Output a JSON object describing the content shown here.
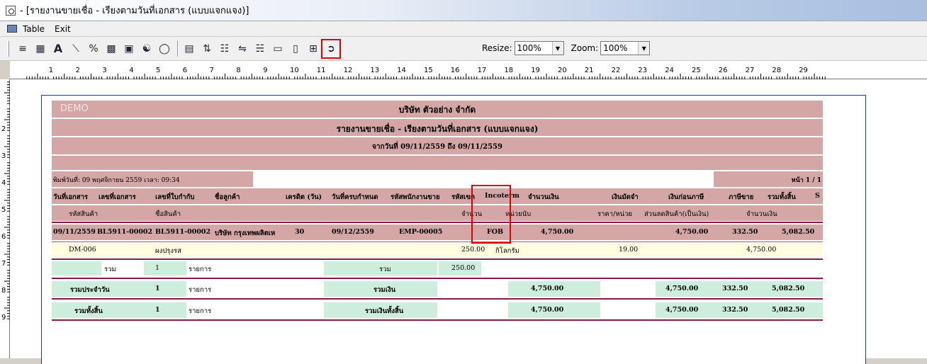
{
  "window": {
    "title": " - [รายงานขายเชื่อ - เรียงตามวันที่เอกสาร (แบบแจกแจง)]"
  },
  "menu": {
    "items": [
      "Table",
      "Exit"
    ]
  },
  "toolbar": {
    "resize_label": "Resize:",
    "resize_value": "100%",
    "zoom_label": "Zoom:",
    "zoom_value": "100%",
    "icons": [
      "align-left-icon",
      "table-icon",
      "text-icon",
      "line-icon",
      "percent-icon",
      "grid-icon",
      "image-icon",
      "stamp-icon",
      "eraser-icon",
      "report-icon",
      "sort-icon",
      "group-icon",
      "merge-icon",
      "split-icon",
      "column-icon",
      "row-icon",
      "fit-icon",
      "exit-icon"
    ]
  },
  "ruler": {
    "marks": [
      "1",
      "2",
      "3",
      "4",
      "5",
      "6",
      "7",
      "8",
      "9",
      "10",
      "11",
      "12",
      "13",
      "14",
      "15",
      "16",
      "17",
      "18",
      "19",
      "20",
      "21",
      "22",
      "23",
      "24",
      "25",
      "26",
      "27",
      "28",
      "29"
    ]
  },
  "vruler": {
    "marks": [
      "2",
      "3",
      "4",
      "5",
      "6",
      "7",
      "8",
      "9"
    ]
  },
  "report": {
    "watermark": "DEMO",
    "company": "บริษัท ตัวอย่าง จำกัด",
    "title": "รายงานขายเชื่อ - เรียงตามวันที่เอกสาร (แบบแจกแจง)",
    "date_range": "จากวันที่ 09/11/2559 ถึง 09/11/2559",
    "printed": "พิมพ์วันที่: 09 พฤศจิกายน 2559 เวลา: 09:34",
    "page": "หน้า 1 / 1",
    "headers1": [
      "วันที่เอกสาร",
      "เลขที่เอกสาร",
      "เลขที่ใบกำกับ",
      "ชื่อลูกค้า",
      "เครดิต (วัน)",
      "วันที่ครบกำหนด",
      "รหัสพนักงานขาย",
      "รหัสเขต",
      "Incoterm",
      "จำนวนเงิน",
      "เงินมัดจำ",
      "เงินก่อนภาษี",
      "ภาษีขาย",
      "รวมทั้งสิ้น",
      "S"
    ],
    "headers2": [
      "รหัสสินค้า",
      "ชื่อสินค้า",
      "จำนวน",
      "หน่วยนับ",
      "ราคา/หน่วย",
      "ส่วนลดสินค้า(เป็นเงิน)",
      "จำนวนเงิน"
    ],
    "doc_row": [
      "09/11/2559",
      "BL5911-00002",
      "BL5911-00002",
      "บริษัท กรุงเทพผลิตเห",
      "30",
      "09/12/2559",
      "EMP-00005",
      "FOB",
      "4,750.00",
      "4,750.00",
      "332.50",
      "5,082.50"
    ],
    "item_row": [
      "DM-006",
      "ผงปรุงรส",
      "250.00",
      "กิโลกรัม",
      "19.00",
      "4,750.00"
    ],
    "sum_row": [
      "รวม",
      "1",
      "รายการ",
      "รวม",
      "250.00"
    ],
    "daily_row": [
      "รวมประจำวัน",
      "1",
      "รายการ",
      "รวมเงิน",
      "4,750.00",
      "4,750.00",
      "332.50",
      "5,082.50"
    ],
    "total_row": [
      "รวมทั้งสิ้น",
      "1",
      "รายการ",
      "รวมเงินทั้งสิ้น",
      "4,750.00",
      "4,750.00",
      "332.50",
      "5,082.50"
    ]
  },
  "colors": {
    "band": "#d4a6a6",
    "accent": "#8b1a4a",
    "highlight": "#e00000",
    "green": "#cdeedd",
    "yellow": "#fffde0"
  }
}
